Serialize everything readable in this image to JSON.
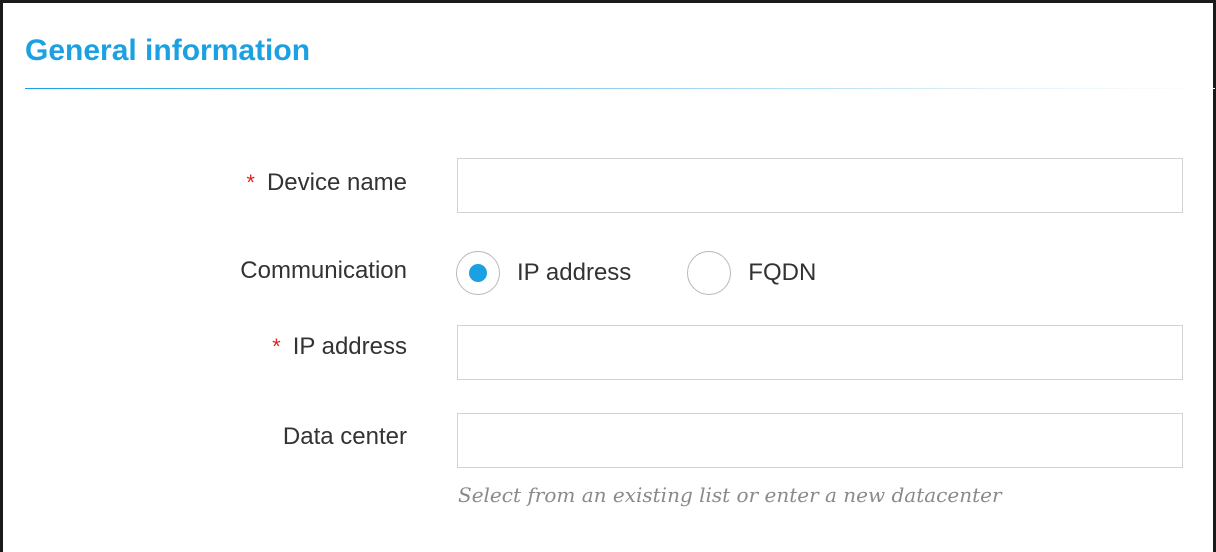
{
  "section": {
    "title": "General information"
  },
  "form": {
    "device_name": {
      "required_marker": "*",
      "label": "Device name",
      "value": "",
      "placeholder": ""
    },
    "communication": {
      "label": "Communication",
      "options": [
        {
          "label": "IP address",
          "selected": true
        },
        {
          "label": "FQDN",
          "selected": false
        }
      ]
    },
    "ip_address": {
      "required_marker": "*",
      "label": "IP address",
      "value": "",
      "placeholder": ""
    },
    "data_center": {
      "label": "Data center",
      "value": "",
      "placeholder": "",
      "hint": "Select from an existing list or enter a new datacenter"
    }
  },
  "colors": {
    "accent": "#1ba1e2",
    "required": "#e02424",
    "label_text": "#333333",
    "hint_text": "#8a8a8a",
    "input_border": "#d3d3d3"
  },
  "icons": {
    "radio_selected": "radio-selected-icon",
    "radio_unselected": "radio-unselected-icon"
  }
}
